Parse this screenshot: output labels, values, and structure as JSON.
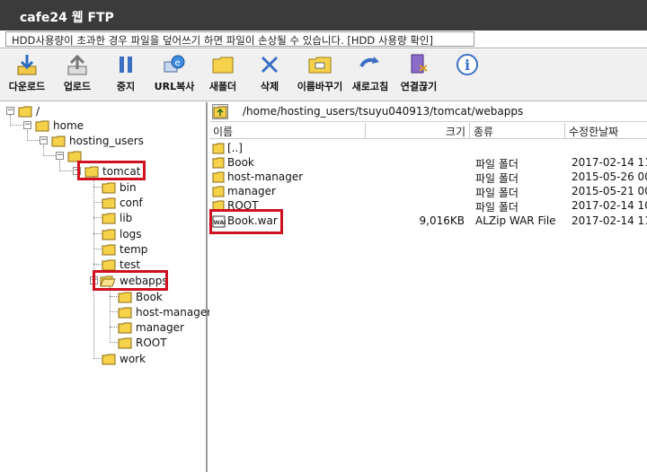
{
  "window": {
    "title": "cafe24 웹 FTP"
  },
  "notice": {
    "text": "HDD사용량이 초과한 경우 파일을 덮어쓰기 하면 파일이 손상될 수 있습니다. [HDD 사용량 확인]"
  },
  "toolbar": {
    "buttons": [
      {
        "label": "다운로드",
        "icon": "download-icon"
      },
      {
        "label": "업로드",
        "icon": "upload-icon"
      },
      {
        "label": "중지",
        "icon": "pause-icon"
      },
      {
        "label": "URL복사",
        "icon": "url-copy-icon"
      },
      {
        "label": "새폴더",
        "icon": "new-folder-icon"
      },
      {
        "label": "삭제",
        "icon": "delete-icon"
      },
      {
        "label": "이름바꾸기",
        "icon": "rename-icon"
      },
      {
        "label": "새로고침",
        "icon": "refresh-icon"
      },
      {
        "label": "연결끊기",
        "icon": "disconnect-icon"
      },
      {
        "label": "",
        "icon": "info-icon"
      }
    ]
  },
  "tree": {
    "nodes": [
      {
        "label": "/"
      },
      {
        "label": "home"
      },
      {
        "label": "hosting_users"
      },
      {
        "label": ""
      },
      {
        "label": "tomcat"
      },
      {
        "label": "bin"
      },
      {
        "label": "conf"
      },
      {
        "label": "lib"
      },
      {
        "label": "logs"
      },
      {
        "label": "temp"
      },
      {
        "label": "test"
      },
      {
        "label": "webapps"
      },
      {
        "label": "Book"
      },
      {
        "label": "host-manager"
      },
      {
        "label": "manager"
      },
      {
        "label": "ROOT"
      },
      {
        "label": "work"
      }
    ]
  },
  "filelist": {
    "path": "/home/hosting_users/tsuyu040913/tomcat/webapps",
    "columns": {
      "name": "이름",
      "size": "크기",
      "type": "종류",
      "date": "수정한날짜"
    },
    "rows": [
      {
        "name": "[..]",
        "size": "",
        "type": "",
        "date": ""
      },
      {
        "name": "Book",
        "size": "",
        "type": "파일 폴더",
        "date": "2017-02-14 11:"
      },
      {
        "name": "host-manager",
        "size": "",
        "type": "파일 폴더",
        "date": "2015-05-26 00:"
      },
      {
        "name": "manager",
        "size": "",
        "type": "파일 폴더",
        "date": "2015-05-21 00:"
      },
      {
        "name": "ROOT",
        "size": "",
        "type": "파일 폴더",
        "date": "2017-02-14 10:"
      },
      {
        "name": "Book.war",
        "size": "9,016KB",
        "type": "ALZip WAR File",
        "date": "2017-02-14 11:"
      }
    ]
  },
  "colors": {
    "highlight": "#d01020",
    "folder": "#f5d24a",
    "titlebar": "#3b3b3b"
  }
}
